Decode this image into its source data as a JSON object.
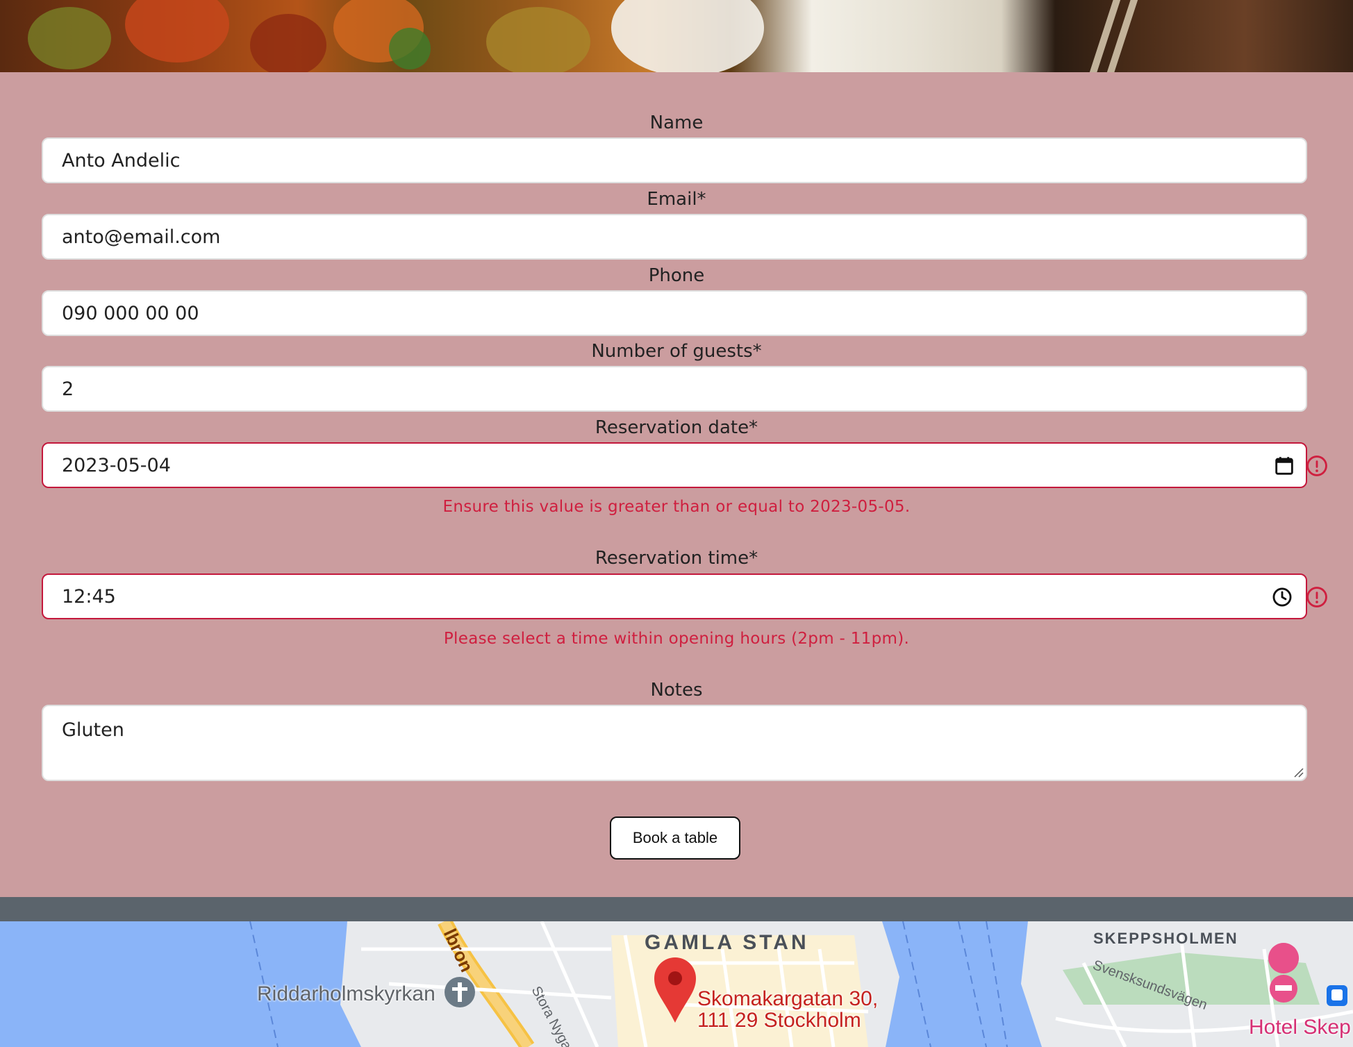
{
  "form": {
    "name": {
      "label": "Name",
      "value": "Anto Andelic"
    },
    "email": {
      "label": "Email*",
      "value": "anto@email.com"
    },
    "phone": {
      "label": "Phone",
      "value": "090 000 00 00"
    },
    "guests": {
      "label": "Number of guests*",
      "value": "2"
    },
    "date": {
      "label": "Reservation date*",
      "value": "2023-05-04",
      "error": "Ensure this value is greater than or equal to 2023-05-05.",
      "icon": "calendar-icon"
    },
    "time": {
      "label": "Reservation time*",
      "value": "12:45",
      "error": "Please select a time within opening hours (2pm - 11pm).",
      "icon": "clock-icon"
    },
    "notes": {
      "label": "Notes",
      "value": "Gluten"
    },
    "submit_label": "Book a table"
  },
  "map": {
    "district_labels": [
      "GAMLA STAN",
      "SKEPPSHOLMEN"
    ],
    "church_label": "Riddarholmskyrkan",
    "street_labels": [
      "Stora Nygatan",
      "Svensksundsvägen"
    ],
    "bridge_label": "lbron",
    "marker_address_line1": "Skomakargatan 30,",
    "marker_address_line2": "111 29 Stockholm",
    "hotel_label": "Hotel Skep"
  },
  "colors": {
    "form_background": "#cb9d9f",
    "error": "#cf1f3f",
    "band": "#5b646c",
    "water": "#8ab4f8",
    "marker": "#e53935"
  }
}
